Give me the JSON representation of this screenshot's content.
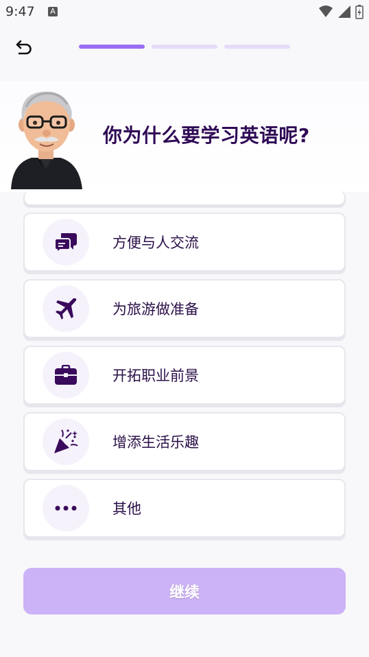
{
  "status_bar": {
    "time": "9:47",
    "notification_letter": "A"
  },
  "nav": {
    "back_icon": "undo-arrow-icon",
    "progress_segments": [
      {
        "active": true
      },
      {
        "active": false
      },
      {
        "active": false
      }
    ]
  },
  "header": {
    "question": "你为什么要学习英语呢?"
  },
  "options": [
    {
      "label": "方便与人交流",
      "icon": "chat-bubbles-icon"
    },
    {
      "label": "为旅游做准备",
      "icon": "airplane-icon"
    },
    {
      "label": "开拓职业前景",
      "icon": "briefcase-icon"
    },
    {
      "label": "增添生活乐趣",
      "icon": "party-popper-icon"
    },
    {
      "label": "其他",
      "icon": "more-dots-icon"
    }
  ],
  "footer": {
    "continue_label": "继续"
  },
  "colors": {
    "accent": "#9b6ef3",
    "accent_light": "#e4dcf7",
    "button_disabled": "#ccb2f6",
    "text_dark": "#2a0f47",
    "icon_color": "#3a0a5c"
  }
}
